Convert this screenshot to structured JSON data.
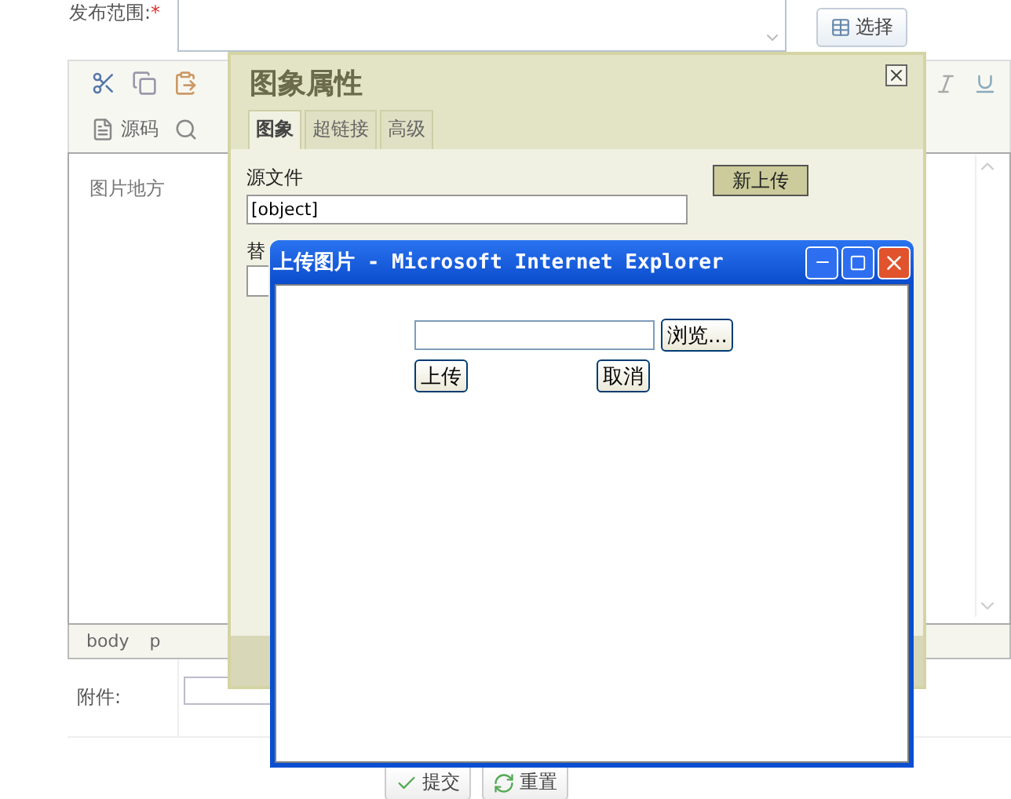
{
  "form": {
    "scope_label": "发布范围:",
    "required_mark": "*",
    "select_button": "选择"
  },
  "toolbar": {
    "source_button": "源码"
  },
  "editor": {
    "content": "图片地方",
    "path": [
      "body",
      "p"
    ]
  },
  "attachment": {
    "label": "附件:"
  },
  "actions": [
    "提交",
    "重置"
  ],
  "image_dialog": {
    "title": "图象属性",
    "tabs": [
      {
        "label": "图象",
        "selected": true
      },
      {
        "label": "超链接",
        "selected": false
      },
      {
        "label": "高级",
        "selected": false
      }
    ],
    "source_label": "源文件",
    "source_value": "[object]",
    "upload_button": "新上传",
    "alt_label": "替"
  },
  "upload_window": {
    "title": "上传图片 - Microsoft Internet Explorer",
    "browse_button": "浏览...",
    "upload_button": "上传",
    "cancel_button": "取消"
  }
}
